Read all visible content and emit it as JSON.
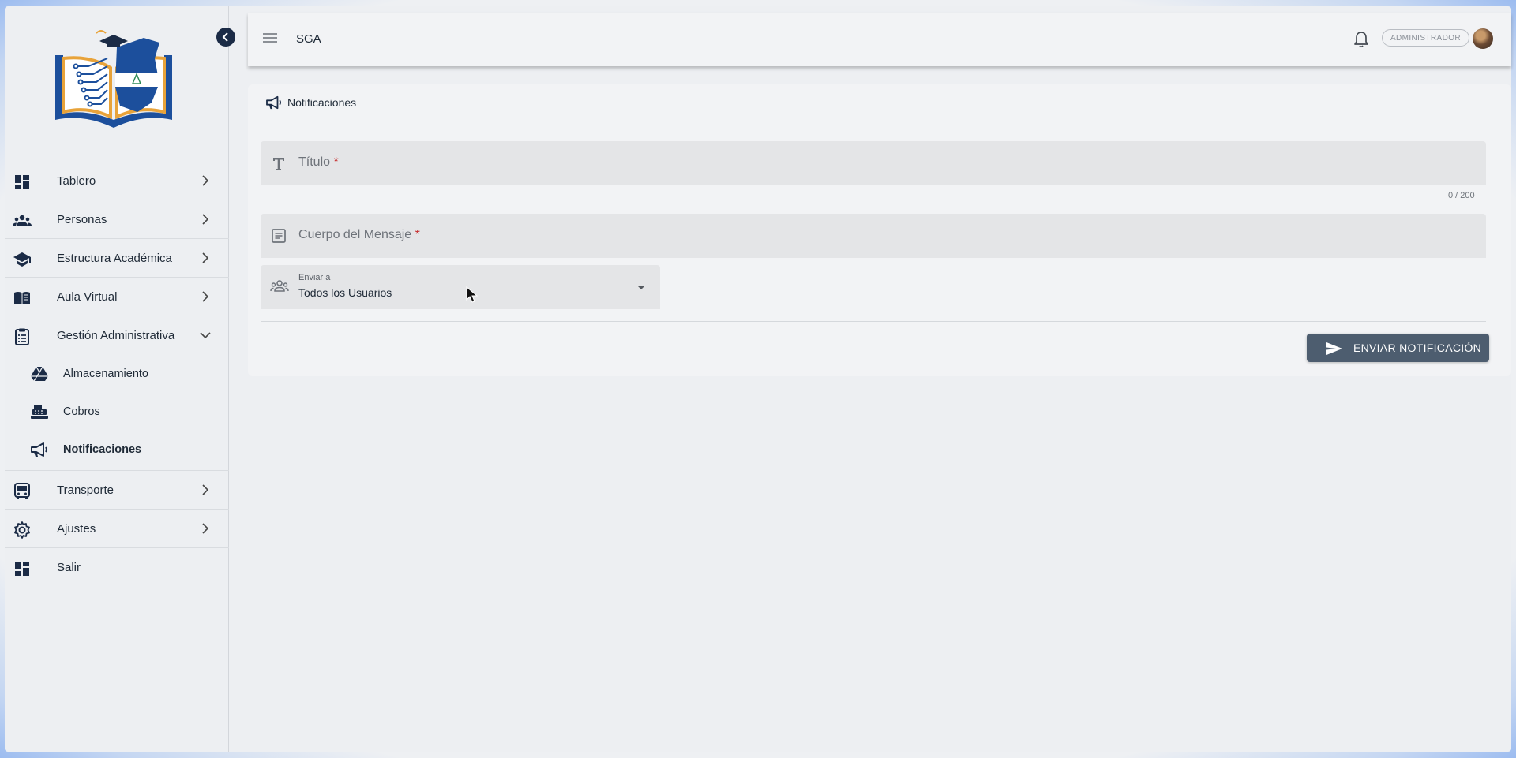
{
  "header": {
    "app_title": "SGA",
    "role_badge": "ADMINISTRADOR"
  },
  "sidebar": {
    "items": [
      {
        "label": "Tablero",
        "icon": "dashboard-icon",
        "expandable": true
      },
      {
        "label": "Personas",
        "icon": "people-icon",
        "expandable": true
      },
      {
        "label": "Estructura Académica",
        "icon": "school-icon",
        "expandable": true
      },
      {
        "label": "Aula Virtual",
        "icon": "book-icon",
        "expandable": true
      },
      {
        "label": "Gestión Administrativa",
        "icon": "clipboard-icon",
        "expanded": true,
        "children": [
          {
            "label": "Almacenamiento",
            "icon": "drive-icon"
          },
          {
            "label": "Cobros",
            "icon": "cash-register-icon"
          },
          {
            "label": "Notificaciones",
            "icon": "megaphone-icon",
            "active": true
          }
        ]
      },
      {
        "label": "Transporte",
        "icon": "bus-icon",
        "expandable": true
      },
      {
        "label": "Ajustes",
        "icon": "gear-icon",
        "expandable": true
      },
      {
        "label": "Salir",
        "icon": "dashboard-icon",
        "expandable": false
      }
    ]
  },
  "card": {
    "title": "Notificaciones",
    "fields": {
      "title_placeholder": "Título",
      "title_counter": "0 / 200",
      "body_placeholder": "Cuerpo del Mensaje",
      "required_mark": "*",
      "send_to_label": "Enviar a",
      "send_to_value": "Todos los Usuarios"
    },
    "submit_label": "ENVIAR NOTIFICACIÓN"
  },
  "colors": {
    "primary_dark": "#1b2b46",
    "button": "#4d5d6f",
    "required": "#c62828"
  }
}
